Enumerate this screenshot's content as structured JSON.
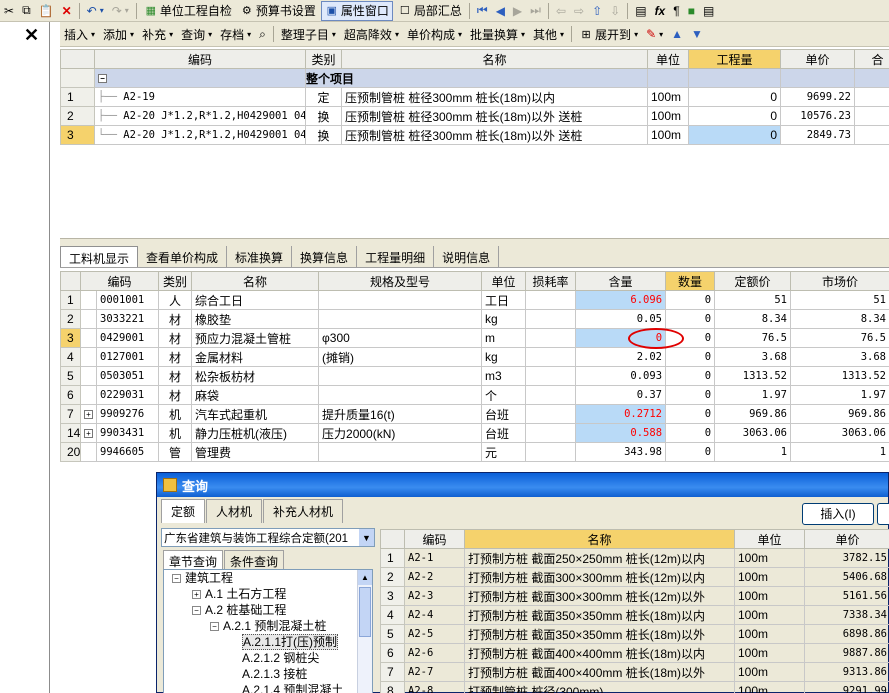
{
  "toolbar1": {
    "items": [
      {
        "label": "单位工程自检",
        "icon": "check-icon"
      },
      {
        "label": "预算书设置",
        "icon": "gear-icon"
      },
      {
        "label": "属性窗口",
        "icon": "window-icon"
      },
      {
        "label": "局部汇总",
        "icon": "checkbox-icon"
      }
    ]
  },
  "toolbar2": {
    "close": "✕",
    "items": [
      "插入",
      "添加",
      "补充",
      "查询",
      "存档",
      "整理子目",
      "超高降效",
      "单价构成",
      "批量换算",
      "其他",
      "展开到"
    ]
  },
  "top_table": {
    "headers": [
      "编码",
      "类别",
      "名称",
      "单位",
      "工程量",
      "单价",
      "合"
    ],
    "group": {
      "label": "整个项目",
      "toggle": "−"
    },
    "rows": [
      {
        "no": "1",
        "code": "A2-19",
        "type": "定",
        "name": "压预制管桩 桩径300mm 桩长(18m)以内",
        "unit": "100m",
        "qty": "0",
        "price": "9699.22"
      },
      {
        "no": "2",
        "code": "A2-20 J*1.2,R*1.2,H0429001 04",
        "type": "换",
        "name": "压预制管桩 桩径300mm 桩长(18m)以外 送桩",
        "unit": "100m",
        "qty": "0",
        "price": "10576.23"
      },
      {
        "no": "3",
        "code": "A2-20 J*1.2,R*1.2,H0429001 04",
        "type": "换",
        "name": "压预制管桩 桩径300mm 桩长(18m)以外 送桩",
        "unit": "100m",
        "qty": "0",
        "price": "2849.73"
      }
    ]
  },
  "mid_tabs": [
    "工料机显示",
    "查看单价构成",
    "标准换算",
    "换算信息",
    "工程量明细",
    "说明信息"
  ],
  "mid_table": {
    "headers": [
      "编码",
      "类别",
      "名称",
      "规格及型号",
      "单位",
      "损耗率",
      "含量",
      "数量",
      "定额价",
      "市场价"
    ],
    "rows": [
      {
        "no": "1",
        "exp": "",
        "code": "0001001",
        "type": "人",
        "name": "综合工日",
        "spec": "",
        "unit": "工日",
        "loss": "",
        "content": "6.096",
        "qty": "0",
        "quota": "51",
        "market": "51"
      },
      {
        "no": "2",
        "exp": "",
        "code": "3033221",
        "type": "材",
        "name": "橡胶垫",
        "spec": "",
        "unit": "kg",
        "loss": "",
        "content": "0.05",
        "qty": "0",
        "quota": "8.34",
        "market": "8.34"
      },
      {
        "no": "3",
        "exp": "",
        "code": "0429001",
        "type": "材",
        "name": "预应力混凝土管桩",
        "spec": "φ300",
        "unit": "m",
        "loss": "",
        "content": "0",
        "qty": "0",
        "quota": "76.5",
        "market": "76.5"
      },
      {
        "no": "4",
        "exp": "",
        "code": "0127001",
        "type": "材",
        "name": "金属材料",
        "spec": "(摊销)",
        "unit": "kg",
        "loss": "",
        "content": "2.02",
        "qty": "0",
        "quota": "3.68",
        "market": "3.68"
      },
      {
        "no": "5",
        "exp": "",
        "code": "0503051",
        "type": "材",
        "name": "松杂板枋材",
        "spec": "",
        "unit": "m3",
        "loss": "",
        "content": "0.093",
        "qty": "0",
        "quota": "1313.52",
        "market": "1313.52"
      },
      {
        "no": "6",
        "exp": "",
        "code": "0229031",
        "type": "材",
        "name": "麻袋",
        "spec": "",
        "unit": "个",
        "loss": "",
        "content": "0.37",
        "qty": "0",
        "quota": "1.97",
        "market": "1.97"
      },
      {
        "no": "7",
        "exp": "+",
        "code": "9909276",
        "type": "机",
        "name": "汽车式起重机",
        "spec": "提升质量16(t)",
        "unit": "台班",
        "loss": "",
        "content": "0.2712",
        "qty": "0",
        "quota": "969.86",
        "market": "969.86"
      },
      {
        "no": "14",
        "exp": "+",
        "code": "9903431",
        "type": "机",
        "name": "静力压桩机(液压)",
        "spec": "压力2000(kN)",
        "unit": "台班",
        "loss": "",
        "content": "0.588",
        "qty": "0",
        "quota": "3063.06",
        "market": "3063.06"
      },
      {
        "no": "20",
        "exp": "",
        "code": "9946605",
        "type": "管",
        "name": "管理费",
        "spec": "",
        "unit": "元",
        "loss": "",
        "content": "343.98",
        "qty": "0",
        "quota": "1",
        "market": "1"
      }
    ]
  },
  "dialog": {
    "title": "查询",
    "tabs": [
      "定额",
      "人材机",
      "补充人材机"
    ],
    "insert_btn": "插入(I)",
    "library": "广东省建筑与装饰工程综合定额(201",
    "subtabs": [
      "章节查询",
      "条件查询"
    ],
    "tree": [
      {
        "label": "建筑工程",
        "level": 0,
        "toggle": "−"
      },
      {
        "label": "A.1 土石方工程",
        "level": 1,
        "toggle": "+"
      },
      {
        "label": "A.2 桩基础工程",
        "level": 1,
        "toggle": "−"
      },
      {
        "label": "A.2.1 预制混凝土桩",
        "level": 2,
        "toggle": "−"
      },
      {
        "label": "A.2.1.1打(压)预制",
        "level": 3,
        "toggle": ""
      },
      {
        "label": "A.2.1.2 钢桩尖",
        "level": 3,
        "toggle": ""
      },
      {
        "label": "A.2.1.3 接桩",
        "level": 3,
        "toggle": ""
      },
      {
        "label": "A.2.1.4 预制混凝土",
        "level": 3,
        "toggle": ""
      }
    ],
    "headers": [
      "编码",
      "名称",
      "单位",
      "单价"
    ],
    "rows": [
      {
        "no": "1",
        "code": "A2-1",
        "name": "打预制方桩 截面250×250mm 桩长(12m)以内",
        "unit": "100m",
        "price": "3782.15"
      },
      {
        "no": "2",
        "code": "A2-2",
        "name": "打预制方桩 截面300×300mm 桩长(12m)以内",
        "unit": "100m",
        "price": "5406.68"
      },
      {
        "no": "3",
        "code": "A2-3",
        "name": "打预制方桩 截面300×300mm 桩长(12m)以外",
        "unit": "100m",
        "price": "5161.56"
      },
      {
        "no": "4",
        "code": "A2-4",
        "name": "打预制方桩 截面350×350mm 桩长(18m)以内",
        "unit": "100m",
        "price": "7338.34"
      },
      {
        "no": "5",
        "code": "A2-5",
        "name": "打预制方桩 截面350×350mm 桩长(18m)以外",
        "unit": "100m",
        "price": "6898.86"
      },
      {
        "no": "6",
        "code": "A2-6",
        "name": "打预制方桩 截面400×400mm 桩长(18m)以内",
        "unit": "100m",
        "price": "9887.86"
      },
      {
        "no": "7",
        "code": "A2-7",
        "name": "打预制方桩 截面400×400mm 桩长(18m)以外",
        "unit": "100m",
        "price": "9313.86"
      },
      {
        "no": "8",
        "code": "A2-8",
        "name": "打预制管桩 桩径(300mm)",
        "unit": "100m",
        "price": "9291.99"
      }
    ]
  },
  "colors": {
    "selection": "#b9daf7",
    "header_highlight": "#f5d26c",
    "group_row": "#ccd6ea",
    "annotation": "#e00000"
  }
}
